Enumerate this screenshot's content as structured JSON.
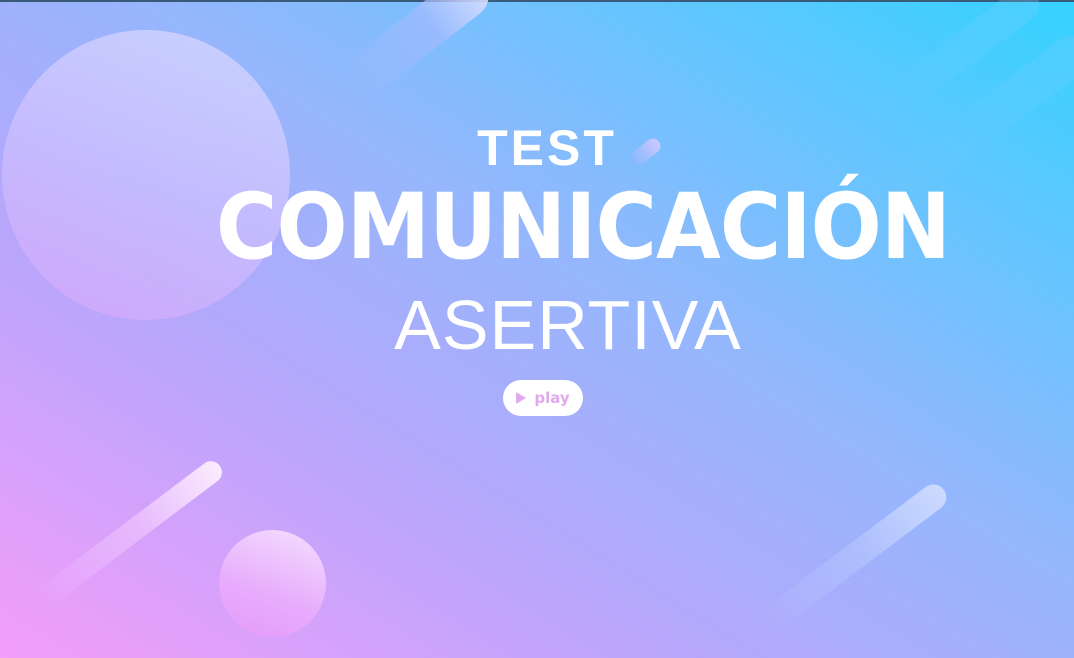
{
  "title": {
    "line1": "TEST",
    "line2": "COMUNICACIÓN",
    "line3": "ASERTIVA"
  },
  "play_button": {
    "label": "play",
    "icon": "play-icon"
  },
  "colors": {
    "gradient_start": "#f49dfb",
    "gradient_end": "#33d2ff",
    "text": "#ffffff",
    "button_accent": "#e3a9ef"
  }
}
